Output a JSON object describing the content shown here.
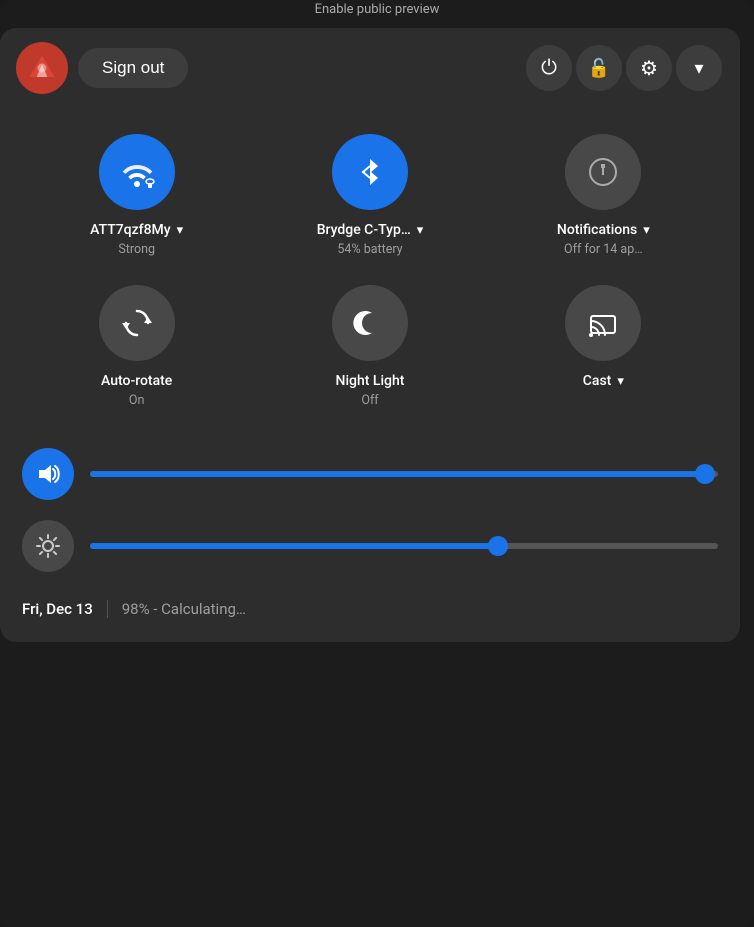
{
  "topHint": "Enable public preview",
  "header": {
    "signOutLabel": "Sign out",
    "powerIcon": "⏻",
    "lockIcon": "🔒",
    "settingsIcon": "⚙",
    "chevronIcon": "▾"
  },
  "tiles": [
    {
      "id": "wifi",
      "label": "ATT7qzf8My",
      "sublabel": "Strong",
      "active": true,
      "hasChevron": true
    },
    {
      "id": "bluetooth",
      "label": "Brydge C-Typ…",
      "sublabel": "54% battery",
      "active": true,
      "hasChevron": true
    },
    {
      "id": "notifications",
      "label": "Notifications",
      "sublabel": "Off for 14 ap…",
      "active": false,
      "hasChevron": true
    },
    {
      "id": "autorotate",
      "label": "Auto-rotate",
      "sublabel": "On",
      "active": false,
      "hasChevron": false
    },
    {
      "id": "nightlight",
      "label": "Night Light",
      "sublabel": "Off",
      "active": false,
      "hasChevron": false
    },
    {
      "id": "cast",
      "label": "Cast",
      "sublabel": "",
      "active": false,
      "hasChevron": true
    }
  ],
  "sliders": {
    "volume": {
      "value": 98,
      "max": 100,
      "iconActive": true
    },
    "brightness": {
      "value": 65,
      "max": 100,
      "iconActive": false
    }
  },
  "footer": {
    "date": "Fri, Dec 13",
    "battery": "98% - Calculating…"
  }
}
